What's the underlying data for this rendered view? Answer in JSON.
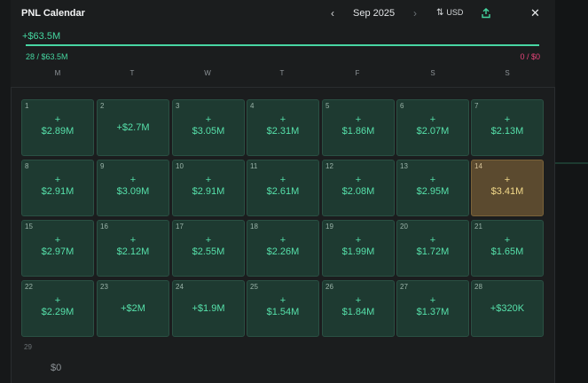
{
  "header": {
    "title": "PNL Calendar",
    "prev": "‹",
    "month": "Sep 2025",
    "next": "›",
    "currency_arrows": "⇅",
    "currency": "USD",
    "close": "✕"
  },
  "summary": {
    "total": "+$63.5M",
    "progress_fraction": 1.0,
    "left_label": "28 / $63.5M",
    "right_label": "0 / $0"
  },
  "weekdays": [
    "M",
    "T",
    "W",
    "T",
    "F",
    "S",
    "S"
  ],
  "days": [
    {
      "n": "1",
      "plus": "+",
      "v": "$2.89M"
    },
    {
      "n": "2",
      "plus": "",
      "v": "+$2.7M"
    },
    {
      "n": "3",
      "plus": "+",
      "v": "$3.05M"
    },
    {
      "n": "4",
      "plus": "+",
      "v": "$2.31M"
    },
    {
      "n": "5",
      "plus": "+",
      "v": "$1.86M"
    },
    {
      "n": "6",
      "plus": "+",
      "v": "$2.07M"
    },
    {
      "n": "7",
      "plus": "+",
      "v": "$2.13M"
    },
    {
      "n": "8",
      "plus": "+",
      "v": "$2.91M"
    },
    {
      "n": "9",
      "plus": "+",
      "v": "$3.09M"
    },
    {
      "n": "10",
      "plus": "+",
      "v": "$2.91M"
    },
    {
      "n": "11",
      "plus": "+",
      "v": "$2.61M"
    },
    {
      "n": "12",
      "plus": "+",
      "v": "$2.08M"
    },
    {
      "n": "13",
      "plus": "+",
      "v": "$2.95M"
    },
    {
      "n": "14",
      "plus": "+",
      "v": "$3.41M",
      "best": true
    },
    {
      "n": "15",
      "plus": "+",
      "v": "$2.97M"
    },
    {
      "n": "16",
      "plus": "+",
      "v": "$2.12M"
    },
    {
      "n": "17",
      "plus": "+",
      "v": "$2.55M"
    },
    {
      "n": "18",
      "plus": "+",
      "v": "$2.26M"
    },
    {
      "n": "19",
      "plus": "+",
      "v": "$1.99M"
    },
    {
      "n": "20",
      "plus": "+",
      "v": "$1.72M"
    },
    {
      "n": "21",
      "plus": "+",
      "v": "$1.65M"
    },
    {
      "n": "22",
      "plus": "+",
      "v": "$2.29M"
    },
    {
      "n": "23",
      "plus": "",
      "v": "+$2M"
    },
    {
      "n": "24",
      "plus": "",
      "v": "+$1.9M"
    },
    {
      "n": "25",
      "plus": "+",
      "v": "$1.54M"
    },
    {
      "n": "26",
      "plus": "+",
      "v": "$1.84M"
    },
    {
      "n": "27",
      "plus": "+",
      "v": "$1.37M"
    },
    {
      "n": "28",
      "plus": "",
      "v": "+$320K"
    }
  ],
  "empty_day": {
    "n": "29",
    "v": "$0"
  },
  "colors": {
    "profit": "#45d6a0",
    "loss": "#e8457b",
    "best_day": "#f2d98a"
  }
}
